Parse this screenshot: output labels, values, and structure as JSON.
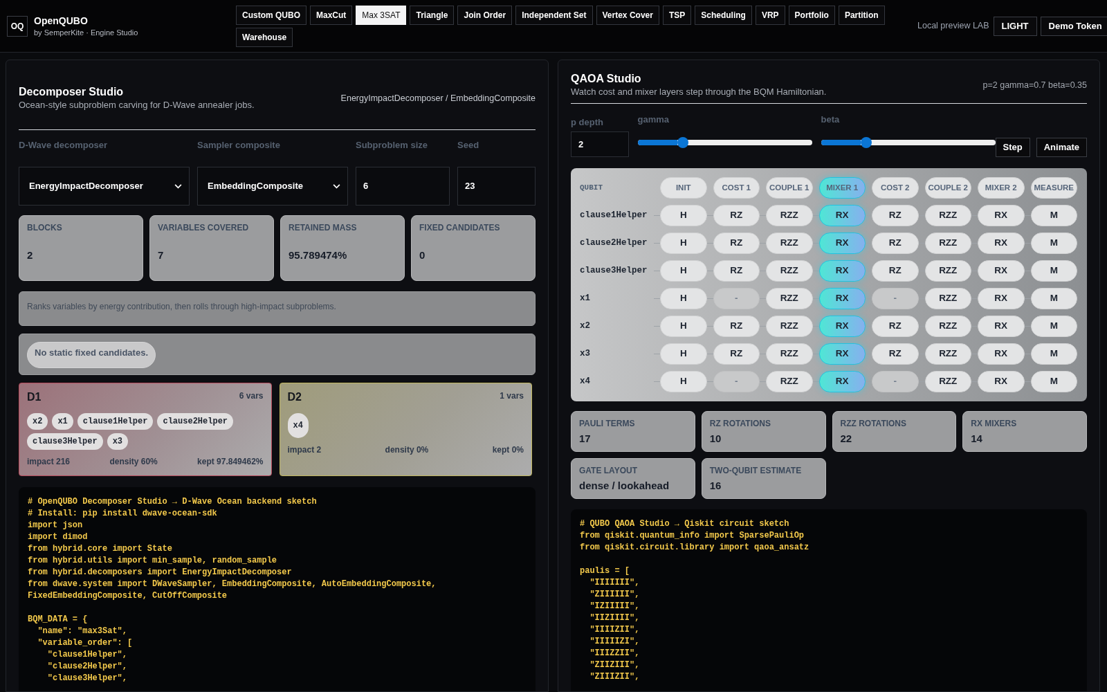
{
  "header": {
    "logo": "OQ",
    "title": "OpenQUBO",
    "subtitle": "by SemperKite · Engine Studio",
    "tabs": [
      {
        "label": "Custom QUBO",
        "selected": false
      },
      {
        "label": "MaxCut",
        "selected": false
      },
      {
        "label": "Max 3SAT",
        "selected": true
      },
      {
        "label": "Triangle",
        "selected": false
      },
      {
        "label": "Join Order",
        "selected": false
      },
      {
        "label": "Independent Set",
        "selected": false
      },
      {
        "label": "Vertex Cover",
        "selected": false
      },
      {
        "label": "TSP",
        "selected": false
      },
      {
        "label": "Scheduling",
        "selected": false
      },
      {
        "label": "VRP",
        "selected": false
      },
      {
        "label": "Portfolio",
        "selected": false
      },
      {
        "label": "Partition",
        "selected": false
      },
      {
        "label": "Warehouse",
        "selected": false
      }
    ],
    "mode_label": "Local preview LAB",
    "buttons": [
      "LIGHT",
      "Demo Token"
    ]
  },
  "decomposer": {
    "title": "Decomposer Studio",
    "subtitle": "Ocean-style subproblem carving for D-Wave annealer jobs.",
    "summary": "EnergyImpactDecomposer / EmbeddingComposite",
    "fields": [
      {
        "label": "D-Wave decomposer",
        "kind": "select",
        "value": "EnergyImpactDecomposer"
      },
      {
        "label": "Sampler composite",
        "kind": "select",
        "value": "EmbeddingComposite"
      },
      {
        "label": "Subproblem size",
        "kind": "input",
        "value": "6"
      },
      {
        "label": "Seed",
        "kind": "input",
        "value": "23"
      }
    ],
    "metrics": [
      {
        "label": "BLOCKS",
        "value": "2"
      },
      {
        "label": "VARIABLES COVERED",
        "value": "7"
      },
      {
        "label": "RETAINED MASS",
        "value": "95.789474%"
      },
      {
        "label": "FIXED CANDIDATES",
        "value": "0"
      }
    ],
    "description": "Ranks variables by energy contribution, then rolls through high-impact subproblems.",
    "fixed_candidates": [
      "No static fixed candidates."
    ],
    "blocks": [
      {
        "name": "D1",
        "vars": "6 vars",
        "color": "#b84a5c",
        "variables": [
          "x2",
          "x1",
          "clause1Helper",
          "clause2Helper",
          "clause3Helper",
          "x3"
        ],
        "impact": "impact 216",
        "density": "density 60%",
        "kept": "kept 97.849462%"
      },
      {
        "name": "D2",
        "vars": "1 vars",
        "color": "#c2b85e",
        "variables": [
          "x4"
        ],
        "impact": "impact 2",
        "density": "density 0%",
        "kept": "kept 0%"
      }
    ],
    "code": "# OpenQUBO Decomposer Studio → D-Wave Ocean backend sketch\n# Install: pip install dwave-ocean-sdk\nimport json\nimport dimod\nfrom hybrid.core import State\nfrom hybrid.utils import min_sample, random_sample\nfrom hybrid.decomposers import EnergyImpactDecomposer\nfrom dwave.system import DWaveSampler, EmbeddingComposite, AutoEmbeddingComposite,\nFixedEmbeddingComposite, CutOffComposite\n\nBQM_DATA = {\n  \"name\": \"max3Sat\",\n  \"variable_order\": [\n    \"clause1Helper\",\n    \"clause2Helper\",\n    \"clause3Helper\","
  },
  "qaoa": {
    "title": "QAOA Studio",
    "subtitle": "Watch cost and mixer layers step through the BQM Hamiltonian.",
    "params": "p=2 gamma=0.7 beta=0.35",
    "depth": {
      "label": "p depth",
      "value": "2"
    },
    "sliders": [
      {
        "label": "gamma",
        "level": 0.26
      },
      {
        "label": "beta",
        "level": 0.26
      }
    ],
    "buttons": [
      "Step",
      "Animate"
    ],
    "circuit": {
      "qubit_header": "QUBIT",
      "layers": [
        {
          "label": "INIT",
          "selected": false
        },
        {
          "label": "COST 1",
          "selected": false
        },
        {
          "label": "COUPLE 1",
          "selected": false
        },
        {
          "label": "MIXER 1",
          "selected": true
        },
        {
          "label": "COST 2",
          "selected": false
        },
        {
          "label": "COUPLE 2",
          "selected": false
        },
        {
          "label": "MIXER 2",
          "selected": false
        },
        {
          "label": "MEASURE",
          "selected": false
        }
      ],
      "rows": [
        {
          "qubit": "clause1Helper",
          "gates": [
            {
              "label": "H",
              "idle": false
            },
            {
              "label": "RZ",
              "idle": false
            },
            {
              "label": "RZZ",
              "idle": false
            },
            {
              "label": "RX",
              "idle": false
            },
            {
              "label": "RZ",
              "idle": false
            },
            {
              "label": "RZZ",
              "idle": false
            },
            {
              "label": "RX",
              "idle": false
            },
            {
              "label": "M",
              "idle": false
            }
          ]
        },
        {
          "qubit": "clause2Helper",
          "gates": [
            {
              "label": "H",
              "idle": false
            },
            {
              "label": "RZ",
              "idle": false
            },
            {
              "label": "RZZ",
              "idle": false
            },
            {
              "label": "RX",
              "idle": false
            },
            {
              "label": "RZ",
              "idle": false
            },
            {
              "label": "RZZ",
              "idle": false
            },
            {
              "label": "RX",
              "idle": false
            },
            {
              "label": "M",
              "idle": false
            }
          ]
        },
        {
          "qubit": "clause3Helper",
          "gates": [
            {
              "label": "H",
              "idle": false
            },
            {
              "label": "RZ",
              "idle": false
            },
            {
              "label": "RZZ",
              "idle": false
            },
            {
              "label": "RX",
              "idle": false
            },
            {
              "label": "RZ",
              "idle": false
            },
            {
              "label": "RZZ",
              "idle": false
            },
            {
              "label": "RX",
              "idle": false
            },
            {
              "label": "M",
              "idle": false
            }
          ]
        },
        {
          "qubit": "x1",
          "gates": [
            {
              "label": "H",
              "idle": false
            },
            {
              "label": "-",
              "idle": true
            },
            {
              "label": "RZZ",
              "idle": false
            },
            {
              "label": "RX",
              "idle": false
            },
            {
              "label": "-",
              "idle": true
            },
            {
              "label": "RZZ",
              "idle": false
            },
            {
              "label": "RX",
              "idle": false
            },
            {
              "label": "M",
              "idle": false
            }
          ]
        },
        {
          "qubit": "x2",
          "gates": [
            {
              "label": "H",
              "idle": false
            },
            {
              "label": "RZ",
              "idle": false
            },
            {
              "label": "RZZ",
              "idle": false
            },
            {
              "label": "RX",
              "idle": false
            },
            {
              "label": "RZ",
              "idle": false
            },
            {
              "label": "RZZ",
              "idle": false
            },
            {
              "label": "RX",
              "idle": false
            },
            {
              "label": "M",
              "idle": false
            }
          ]
        },
        {
          "qubit": "x3",
          "gates": [
            {
              "label": "H",
              "idle": false
            },
            {
              "label": "RZ",
              "idle": false
            },
            {
              "label": "RZZ",
              "idle": false
            },
            {
              "label": "RX",
              "idle": false
            },
            {
              "label": "RZ",
              "idle": false
            },
            {
              "label": "RZZ",
              "idle": false
            },
            {
              "label": "RX",
              "idle": false
            },
            {
              "label": "M",
              "idle": false
            }
          ]
        },
        {
          "qubit": "x4",
          "gates": [
            {
              "label": "H",
              "idle": false
            },
            {
              "label": "-",
              "idle": true
            },
            {
              "label": "RZZ",
              "idle": false
            },
            {
              "label": "RX",
              "idle": false
            },
            {
              "label": "-",
              "idle": true
            },
            {
              "label": "RZZ",
              "idle": false
            },
            {
              "label": "RX",
              "idle": false
            },
            {
              "label": "M",
              "idle": false
            }
          ]
        }
      ]
    },
    "metrics": [
      {
        "label": "PAULI TERMS",
        "value": "17"
      },
      {
        "label": "RZ ROTATIONS",
        "value": "10"
      },
      {
        "label": "RZZ ROTATIONS",
        "value": "22"
      },
      {
        "label": "RX MIXERS",
        "value": "14"
      },
      {
        "label": "GATE LAYOUT",
        "value": "dense / lookahead"
      },
      {
        "label": "TWO-QUBIT ESTIMATE",
        "value": "16"
      }
    ],
    "code": "# QUBO QAOA Studio → Qiskit circuit sketch\nfrom qiskit.quantum_info import SparsePauliOp\nfrom qiskit.circuit.library import qaoa_ansatz\n\npaulis = [\n  \"IIIIIII\",\n  \"ZIIIIII\",\n  \"IZIIIII\",\n  \"IIZIIII\",\n  \"IIIIZII\",\n  \"IIIIIZI\",\n  \"IIIZZII\",\n  \"ZIIZIII\",\n  \"ZIIIZII\","
  }
}
